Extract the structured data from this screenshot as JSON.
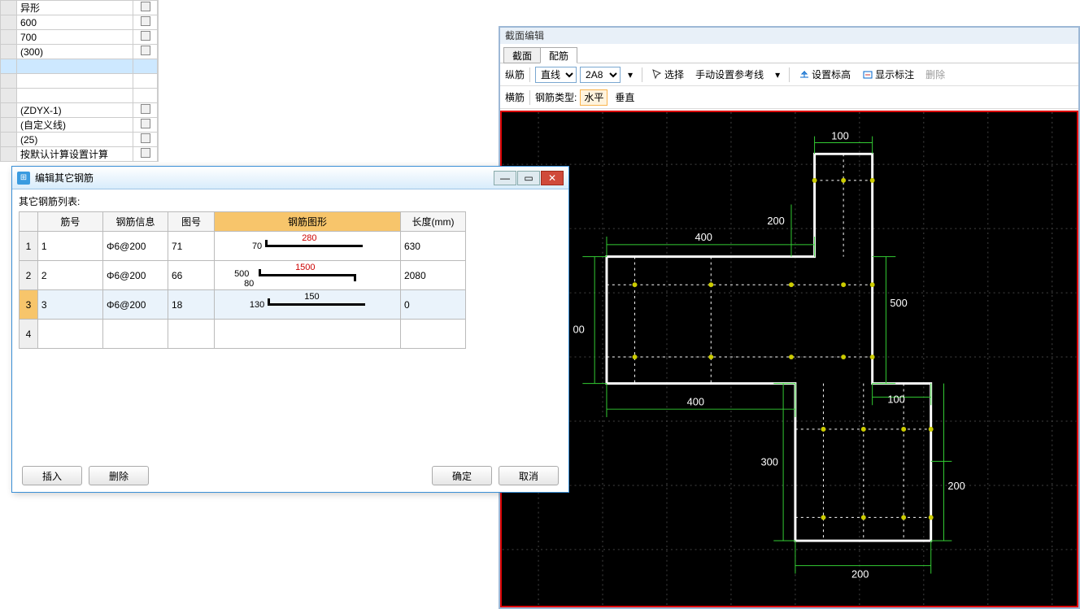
{
  "left_list": {
    "rows": [
      {
        "label": "异形",
        "chk": true
      },
      {
        "label": "600",
        "chk": true
      },
      {
        "label": "700",
        "chk": true
      },
      {
        "label": "(300)",
        "chk": true
      },
      {
        "label": "",
        "chk": false,
        "sel": true
      },
      {
        "label": "",
        "chk": false
      },
      {
        "label": "",
        "chk": false
      },
      {
        "label": "(ZDYX-1)",
        "chk": true
      },
      {
        "label": "(自定义线)",
        "chk": true
      },
      {
        "label": "(25)",
        "chk": true
      },
      {
        "label": "按默认计算设置计算",
        "chk": true
      }
    ]
  },
  "cad": {
    "title": "截面编辑",
    "tabs": {
      "t1": "截面",
      "t2": "配筋"
    },
    "tb": {
      "label_vert": "纵筋",
      "line_mode": "直线",
      "spec": "2A8",
      "select": "选择",
      "manual": "手动设置参考线",
      "elev": "设置标高",
      "show_anno": "显示标注",
      "del": "删除",
      "label_horz": "横筋",
      "rebar_type_label": "钢筋类型:",
      "horz": "水平",
      "vert": "垂直"
    },
    "dims": {
      "d100a": "100",
      "d200a": "200",
      "d400a": "400",
      "d00": "00",
      "d400b": "400",
      "d300": "300",
      "d200b": "200",
      "d500": "500",
      "d100b": "100",
      "d200c": "200"
    }
  },
  "dialog": {
    "title": "编辑其它钢筋",
    "subtitle": "其它钢筋列表:",
    "headers": {
      "h1": "筋号",
      "h2": "钢筋信息",
      "h3": "图号",
      "h4": "钢筋图形",
      "h5": "长度(mm)"
    },
    "rows": [
      {
        "no": "1",
        "id": "1",
        "info": "Φ6@200",
        "fig": "71",
        "s1": "70",
        "s2": "280",
        "len": "630"
      },
      {
        "no": "2",
        "id": "2",
        "info": "Φ6@200",
        "fig": "66",
        "s1": "500",
        "s2": "1500",
        "s3": "80",
        "len": "2080"
      },
      {
        "no": "3",
        "id": "3",
        "info": "Φ6@200",
        "fig": "18",
        "s1": "130",
        "s2": "150",
        "len": "0",
        "sel": true
      },
      {
        "no": "4",
        "id": "",
        "info": "",
        "fig": "",
        "len": ""
      }
    ],
    "btns": {
      "insert": "插入",
      "delete": "删除",
      "ok": "确定",
      "cancel": "取消"
    }
  }
}
